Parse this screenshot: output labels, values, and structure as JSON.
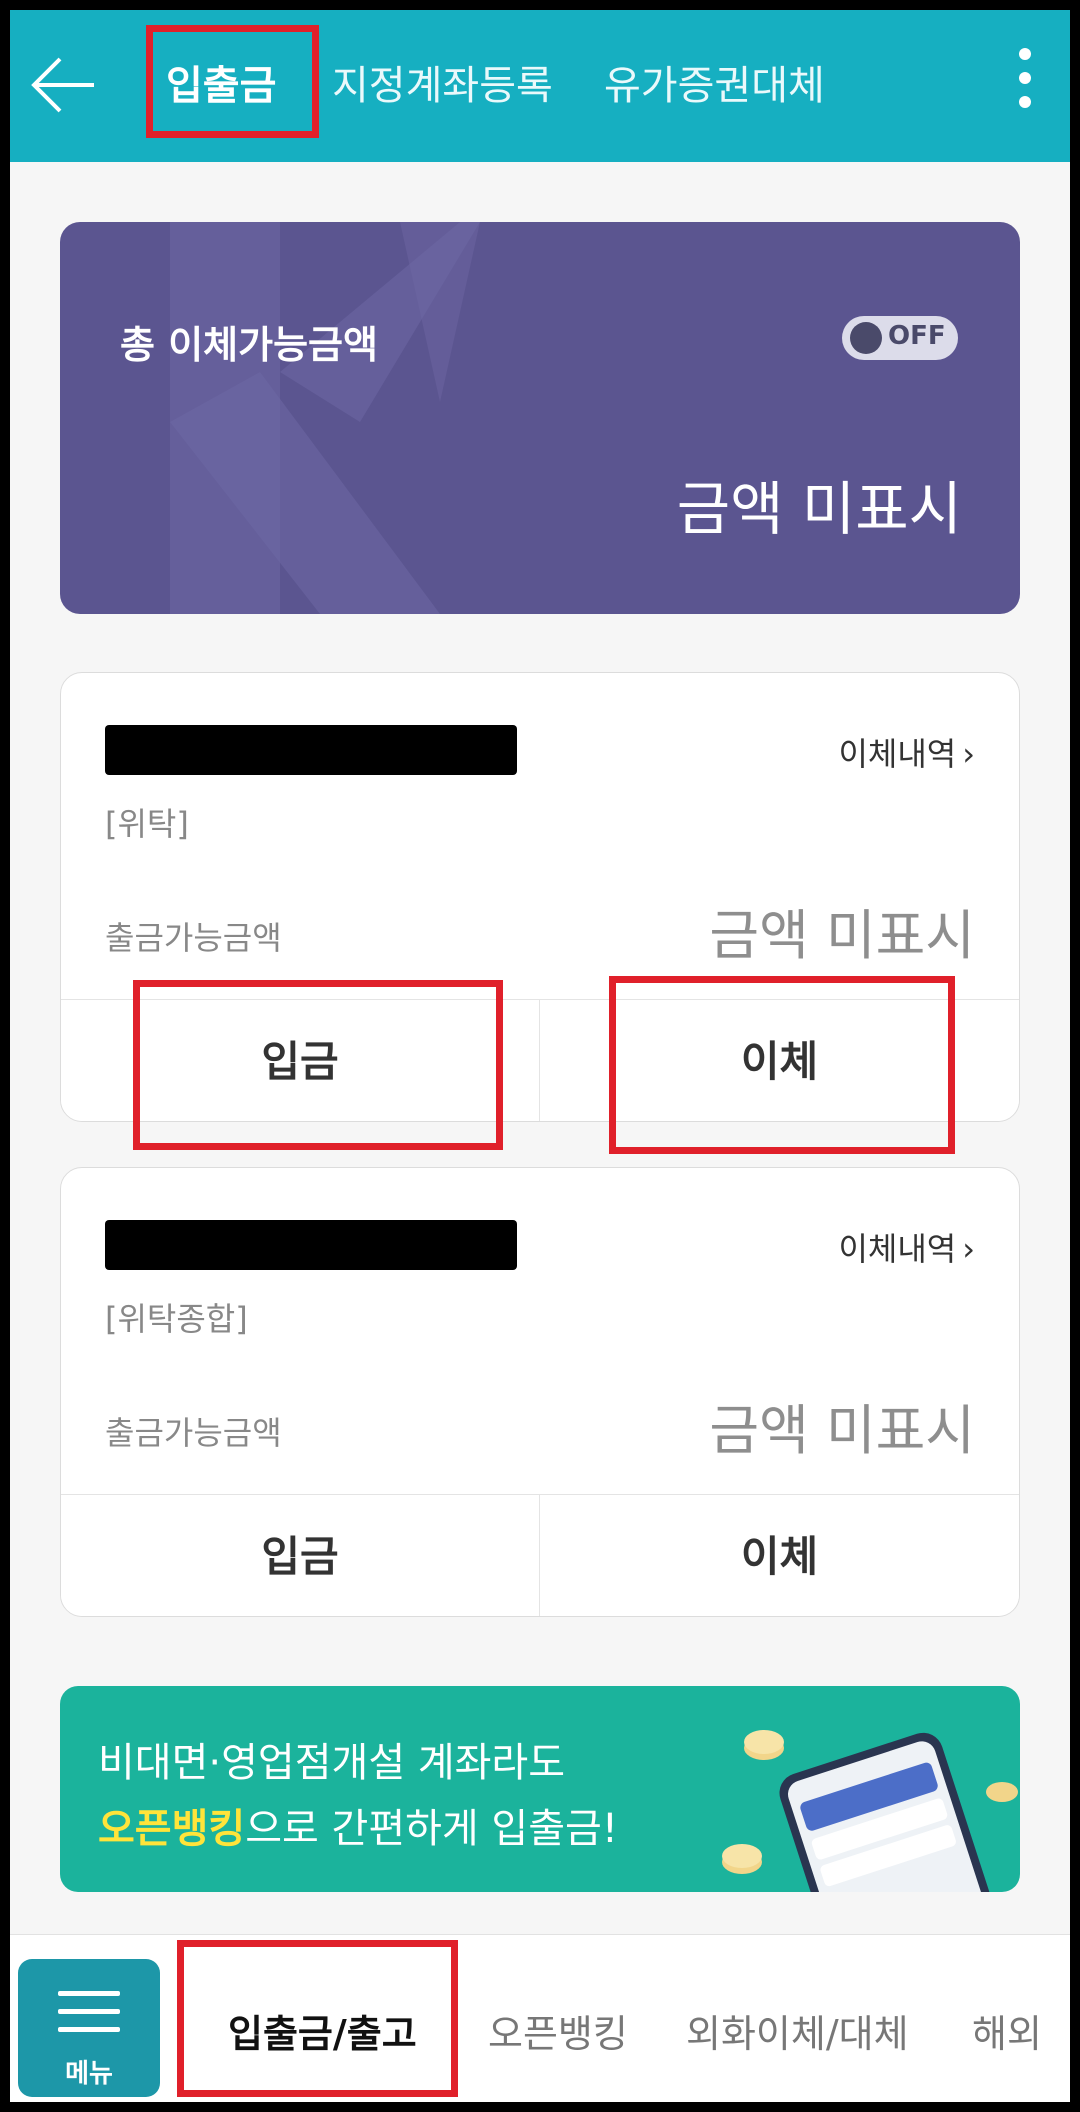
{
  "header": {
    "tabs": [
      {
        "label": "입출금",
        "active": true
      },
      {
        "label": "지정계좌등록",
        "active": false
      },
      {
        "label": "유가증권대체",
        "active": false
      }
    ],
    "back_icon": "arrow-left-icon",
    "more_icon": "more-vertical-icon",
    "bg_color": "#16afc1"
  },
  "balance": {
    "title": "총 이체가능금액",
    "toggle_label": "OFF",
    "toggle_on": false,
    "amount_text": "금액 미표시",
    "bg_color": "#5b5590"
  },
  "accounts": [
    {
      "type": "[위탁]",
      "history_label": "이체내역",
      "withdrawable_label": "출금가능금액",
      "withdrawable_value": "금액 미표시",
      "deposit_label": "입금",
      "transfer_label": "이체"
    },
    {
      "type": "[위탁종합]",
      "history_label": "이체내역",
      "withdrawable_label": "출금가능금액",
      "withdrawable_value": "금액 미표시",
      "deposit_label": "입금",
      "transfer_label": "이체"
    }
  ],
  "banner": {
    "line1": "비대면·영업점개설 계좌라도",
    "line2_highlight": "오픈뱅킹",
    "line2_rest": "으로 간편하게 입출금!",
    "bg_color": "#1bb39c",
    "highlight_color": "#ffe43a"
  },
  "bottom_nav": {
    "menu_label": "메뉴",
    "items": [
      {
        "label": "입출금/출고",
        "active": true
      },
      {
        "label": "오픈뱅킹",
        "active": false
      },
      {
        "label": "외화이체/대체",
        "active": false
      },
      {
        "label": "해외",
        "active": false
      }
    ]
  },
  "annotation_color": "#e0202a"
}
